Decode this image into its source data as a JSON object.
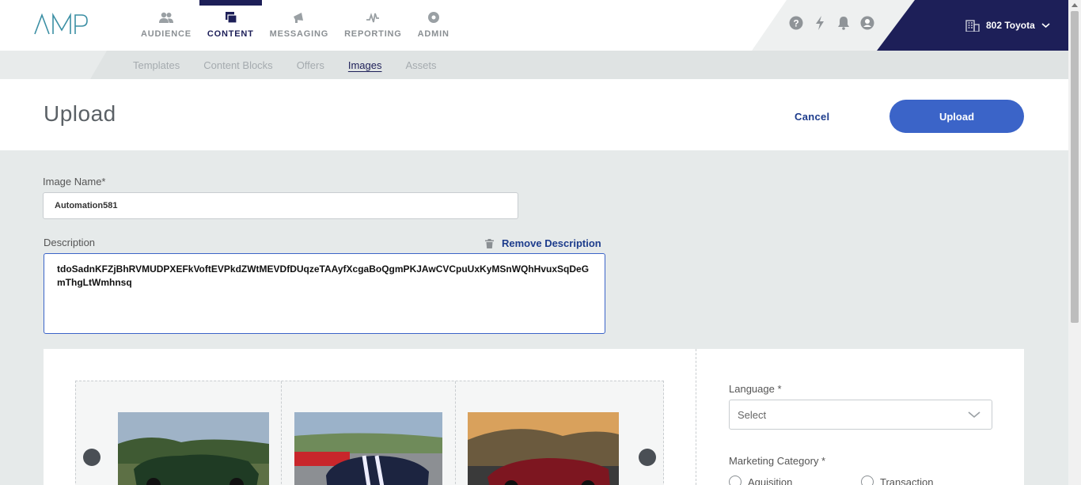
{
  "app": {
    "logo_text": "AMP"
  },
  "nav": {
    "items": [
      {
        "label": "AUDIENCE",
        "icon": "audience-icon"
      },
      {
        "label": "CONTENT",
        "icon": "content-icon",
        "active": true
      },
      {
        "label": "MESSAGING",
        "icon": "megaphone-icon"
      },
      {
        "label": "REPORTING",
        "icon": "pulse-icon"
      },
      {
        "label": "ADMIN",
        "icon": "admin-gear-icon"
      }
    ]
  },
  "utility": {
    "icons": [
      "help-icon",
      "lightning-icon",
      "bell-icon",
      "user-icon"
    ]
  },
  "account": {
    "name": "802 Toyota",
    "icon": "building-icon"
  },
  "subnav": {
    "items": [
      {
        "label": "Templates"
      },
      {
        "label": "Content Blocks"
      },
      {
        "label": "Offers"
      },
      {
        "label": "Images",
        "active": true
      },
      {
        "label": "Assets"
      }
    ]
  },
  "header": {
    "title": "Upload",
    "cancel_label": "Cancel",
    "upload_label": "Upload"
  },
  "form": {
    "image_name_label": "Image Name*",
    "image_name_value": "Automation581",
    "description_label": "Description",
    "remove_description_label": "Remove Description",
    "description_value": "tdoSadnKFZjBhRVMUDPXEFkVoftEVPkdZWtMEVDfDUqzeTAAyfXcgaBoQgmPKJAwCVCpuUxKyMSnWQhHvuxSqDeGmThgLtWmhnsq",
    "language_label": "Language *",
    "language_selected": "Select",
    "marketing_category_label": "Marketing Category *",
    "marketing_options": [
      "Aquisition",
      "Transaction"
    ]
  },
  "gallery": {
    "images": [
      "green-mustang-image",
      "blue-shelby-image",
      "red-mustang-image"
    ]
  },
  "colors": {
    "brand": "#1d1f58",
    "accent": "#3b64c8",
    "link": "#1d3c8c"
  }
}
